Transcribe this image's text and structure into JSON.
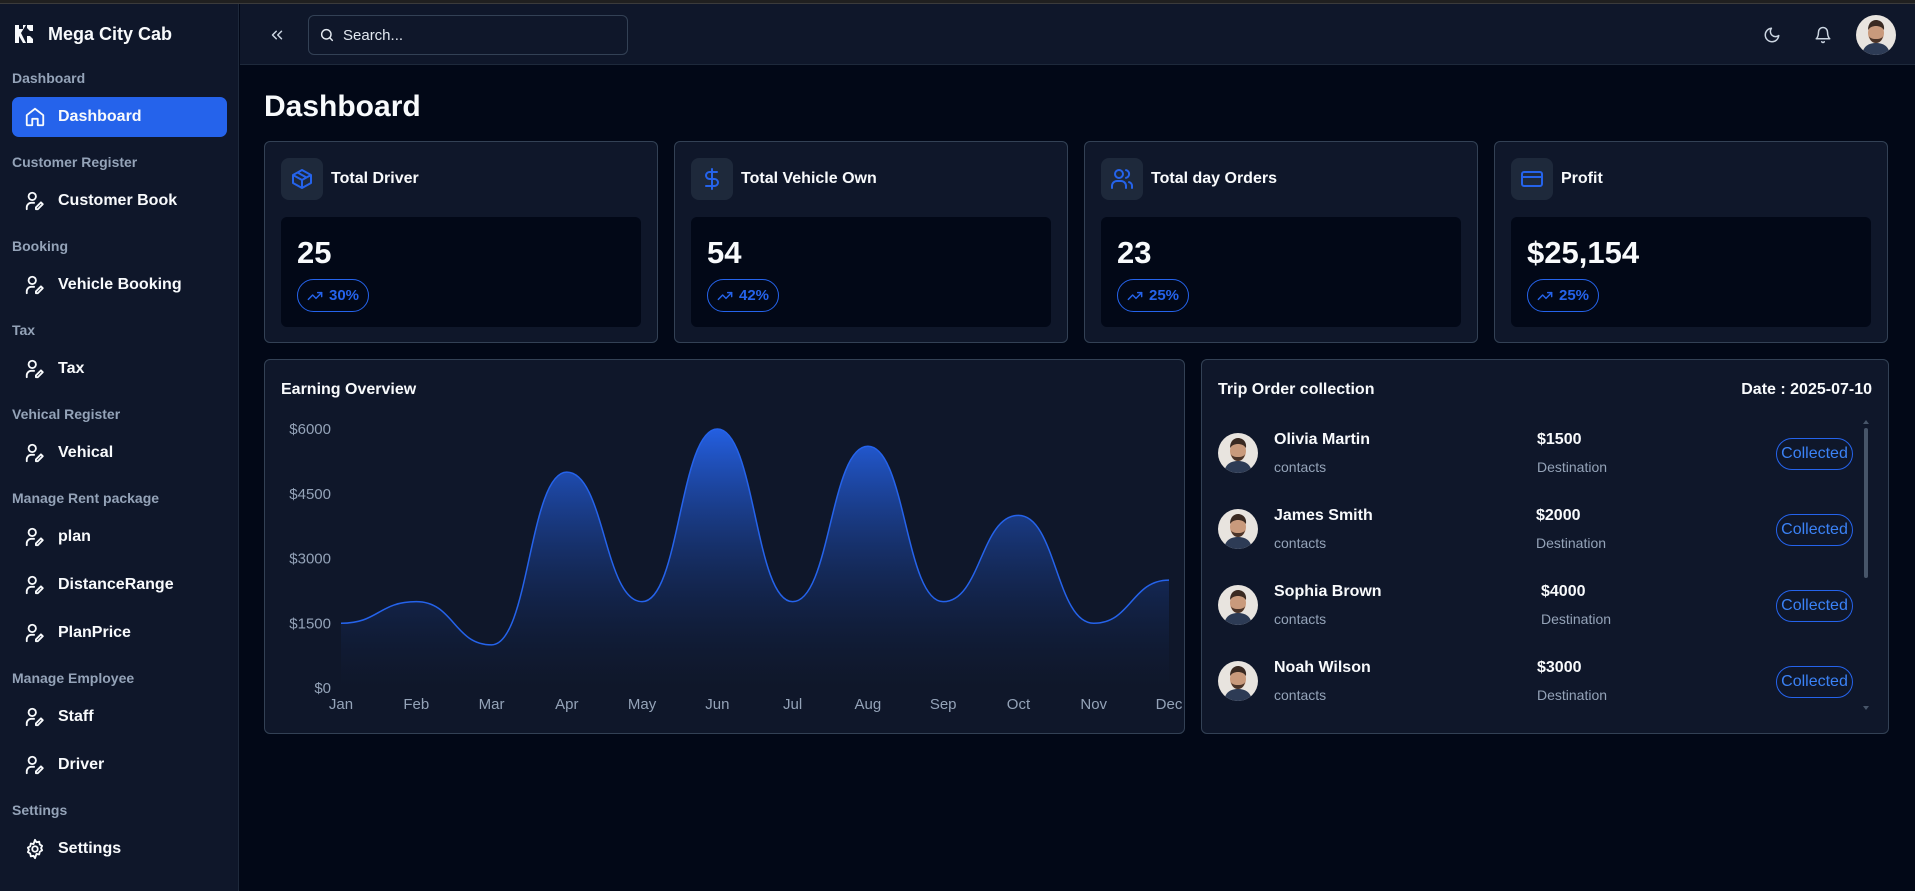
{
  "app": {
    "name": "Mega City Cab"
  },
  "sidebar": {
    "sections": [
      {
        "label": "Dashboard",
        "items": [
          {
            "label": "Dashboard",
            "icon": "home-icon",
            "active": true
          }
        ]
      },
      {
        "label": "Customer Register",
        "items": [
          {
            "label": "Customer Book",
            "icon": "user-pen-icon"
          }
        ]
      },
      {
        "label": "Booking",
        "items": [
          {
            "label": "Vehicle Booking",
            "icon": "user-pen-icon"
          }
        ]
      },
      {
        "label": "Tax",
        "items": [
          {
            "label": "Tax",
            "icon": "user-pen-icon"
          }
        ]
      },
      {
        "label": "Vehical Register",
        "items": [
          {
            "label": "Vehical",
            "icon": "user-pen-icon"
          }
        ]
      },
      {
        "label": "Manage Rent package",
        "items": [
          {
            "label": "plan",
            "icon": "user-pen-icon"
          },
          {
            "label": "DistanceRange",
            "icon": "user-pen-icon"
          },
          {
            "label": "PlanPrice",
            "icon": "user-pen-icon"
          }
        ]
      },
      {
        "label": "Manage Employee",
        "items": [
          {
            "label": "Staff",
            "icon": "user-pen-icon"
          },
          {
            "label": "Driver",
            "icon": "user-pen-icon"
          }
        ]
      },
      {
        "label": "Settings",
        "items": [
          {
            "label": "Settings",
            "icon": "gear-icon"
          }
        ]
      }
    ]
  },
  "topbar": {
    "search_placeholder": "Search...",
    "icons": [
      "collapse-icon",
      "moon-icon",
      "bell-icon"
    ]
  },
  "page": {
    "title": "Dashboard"
  },
  "stats": [
    {
      "title": "Total Driver",
      "value": "25",
      "change": "30%",
      "icon": "box-icon"
    },
    {
      "title": "Total Vehicle Own",
      "value": "54",
      "change": "42%",
      "icon": "dollar-icon"
    },
    {
      "title": "Total day Orders",
      "value": "23",
      "change": "25%",
      "icon": "users-icon"
    },
    {
      "title": "Profit",
      "value": "$25,154",
      "change": "25%",
      "icon": "credit-card-icon"
    }
  ],
  "earning": {
    "title": "Earning Overview"
  },
  "chart_data": {
    "type": "area",
    "title": "Earning Overview",
    "categories": [
      "Jan",
      "Feb",
      "Mar",
      "Apr",
      "May",
      "Jun",
      "Jul",
      "Aug",
      "Sep",
      "Oct",
      "Nov",
      "Dec"
    ],
    "values": [
      1500,
      2000,
      1000,
      5000,
      2000,
      6000,
      2000,
      5600,
      2000,
      4000,
      1500,
      2500
    ],
    "y_ticks": [
      "$0",
      "$1500",
      "$3000",
      "$4500",
      "$6000"
    ],
    "ylim": [
      0,
      6000
    ],
    "grid": false,
    "color": "#2563eb"
  },
  "trips": {
    "title": "Trip Order collection",
    "date": "Date : 2025-07-10",
    "rows": [
      {
        "name": "Olivia Martin",
        "sub": "contacts",
        "amount": "$1500",
        "dest": "Destination",
        "status": "Collected"
      },
      {
        "name": "James Smith",
        "sub": "contacts",
        "amount": "$2000",
        "dest": "Destination",
        "status": "Collected"
      },
      {
        "name": "Sophia Brown",
        "sub": "contacts",
        "amount": "$4000",
        "dest": "Destination",
        "status": "Collected"
      },
      {
        "name": "Noah Wilson",
        "sub": "contacts",
        "amount": "$3000",
        "dest": "Destination",
        "status": "Collected"
      }
    ]
  },
  "colors": {
    "accent": "#2563eb",
    "background": "#020817",
    "card": "#0f172a",
    "border": "#334155",
    "muted": "#94a3b8"
  }
}
